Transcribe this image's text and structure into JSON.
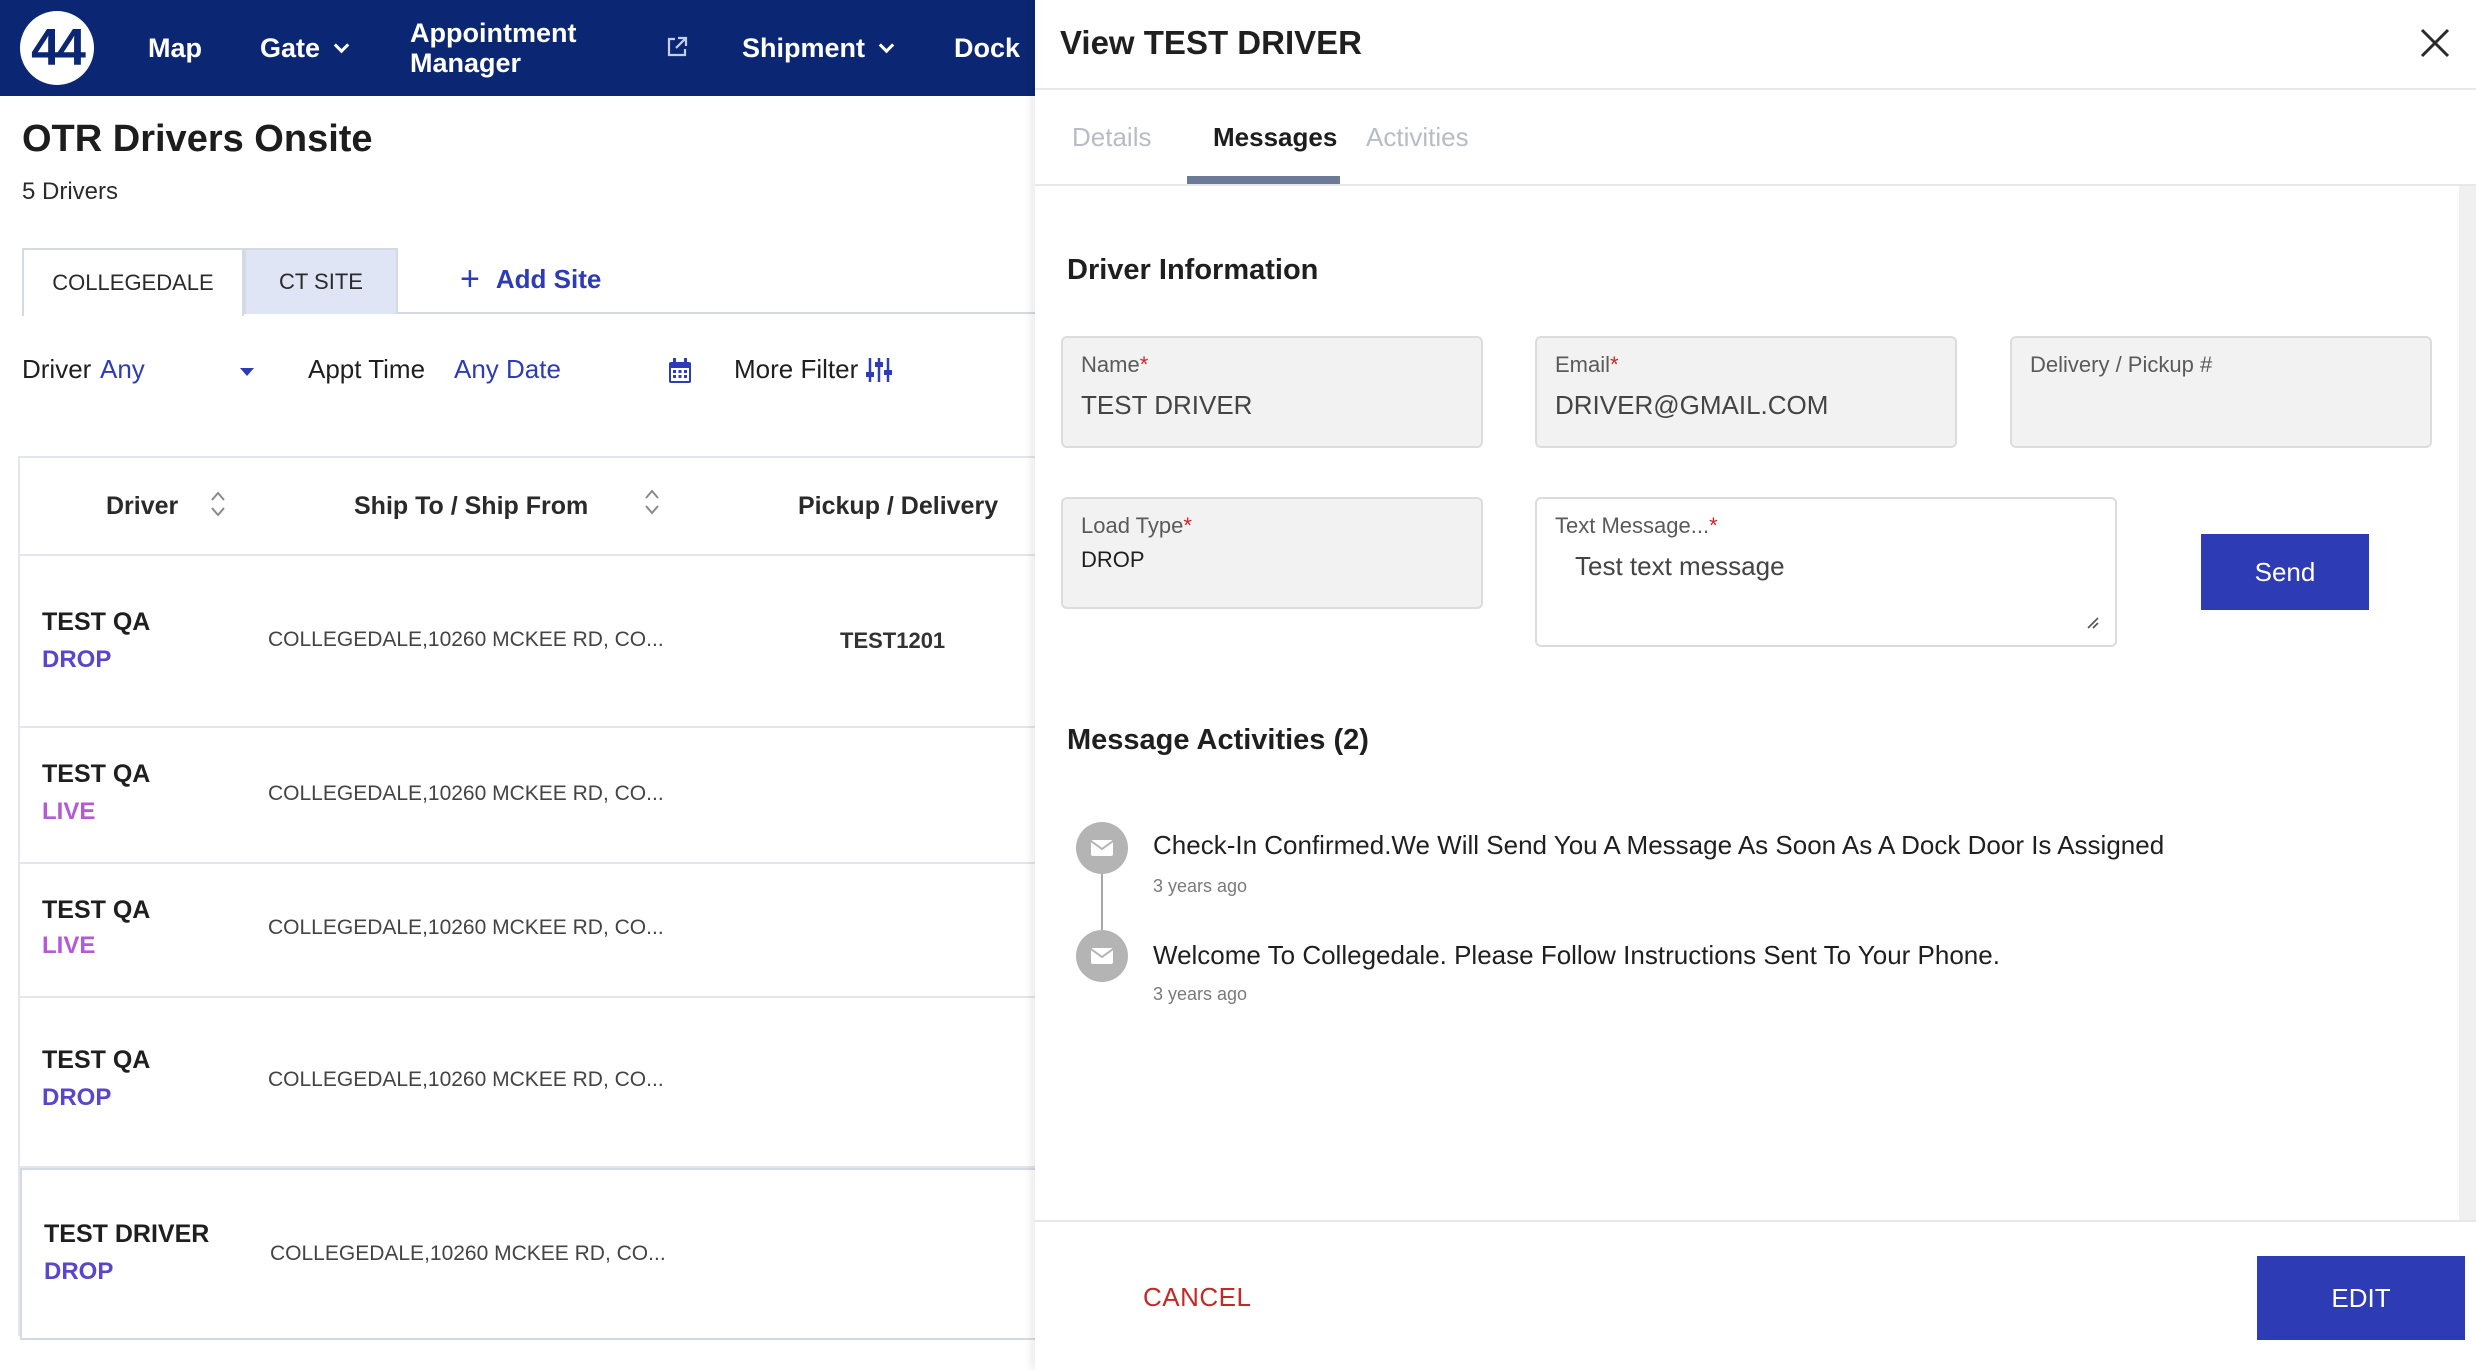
{
  "nav": {
    "logo_text": "44",
    "items": {
      "map": "Map",
      "gate": "Gate",
      "appointment_manager": "Appointment Manager",
      "shipment": "Shipment",
      "dock": "Dock"
    },
    "bg_color": "#0b2672"
  },
  "page": {
    "title": "OTR Drivers Onsite",
    "subtitle": "5 Drivers"
  },
  "site_tabs": {
    "tabs": [
      "COLLEGEDALE",
      "CT SITE"
    ],
    "add_label": "Add Site",
    "active": "COLLEGEDALE"
  },
  "filters": {
    "driver_label": "Driver",
    "driver_value": "Any",
    "appt_label": "Appt Time",
    "appt_value": "Any Date",
    "more_label": "More Filter"
  },
  "table": {
    "columns": [
      "Driver",
      "Ship To / Ship From",
      "Pickup / Delivery"
    ],
    "rows": [
      {
        "name": "TEST QA",
        "type": "DROP",
        "address": "COLLEGEDALE,10260 MCKEE RD, CO...",
        "pickup": "TEST1201"
      },
      {
        "name": "TEST QA",
        "type": "LIVE",
        "address": "COLLEGEDALE,10260 MCKEE RD, CO...",
        "pickup": ""
      },
      {
        "name": "TEST QA",
        "type": "LIVE",
        "address": "COLLEGEDALE,10260 MCKEE RD, CO...",
        "pickup": ""
      },
      {
        "name": "TEST QA",
        "type": "DROP",
        "address": "COLLEGEDALE,10260 MCKEE RD, CO...",
        "pickup": ""
      },
      {
        "name": "TEST DRIVER",
        "type": "DROP",
        "address": "COLLEGEDALE,10260 MCKEE RD, CO...",
        "pickup": ""
      }
    ],
    "type_colors": {
      "DROP": "#5b45c9",
      "LIVE": "#b35bd6"
    }
  },
  "drawer": {
    "title": "View TEST DRIVER",
    "tabs": {
      "details": "Details",
      "messages": "Messages",
      "activities": "Activities"
    },
    "active_tab": "Messages",
    "driver_info_heading": "Driver Information",
    "fields": {
      "name_label": "Name",
      "name_value": "TEST DRIVER",
      "email_label": "Email",
      "email_value": "DRIVER@GMAIL.COM",
      "delivery_label": "Delivery / Pickup #",
      "delivery_value": "",
      "load_type_label": "Load Type",
      "load_type_value": "DROP",
      "text_message_label": "Text Message...",
      "text_message_value": "Test text message",
      "required_mark": "*"
    },
    "send_label": "Send",
    "activities_heading": "Message Activities (2)",
    "messages": [
      {
        "text": "Check-In Confirmed.We Will Send You A Message As Soon As A Dock Door Is Assigned",
        "time": "3 years ago"
      },
      {
        "text": "Welcome To Collegedale. Please Follow Instructions Sent To Your Phone.",
        "time": "3 years ago"
      }
    ],
    "cancel_label": "CANCEL",
    "edit_label": "EDIT",
    "accent_color": "#2d3bb5",
    "cancel_color": "#c62828"
  }
}
